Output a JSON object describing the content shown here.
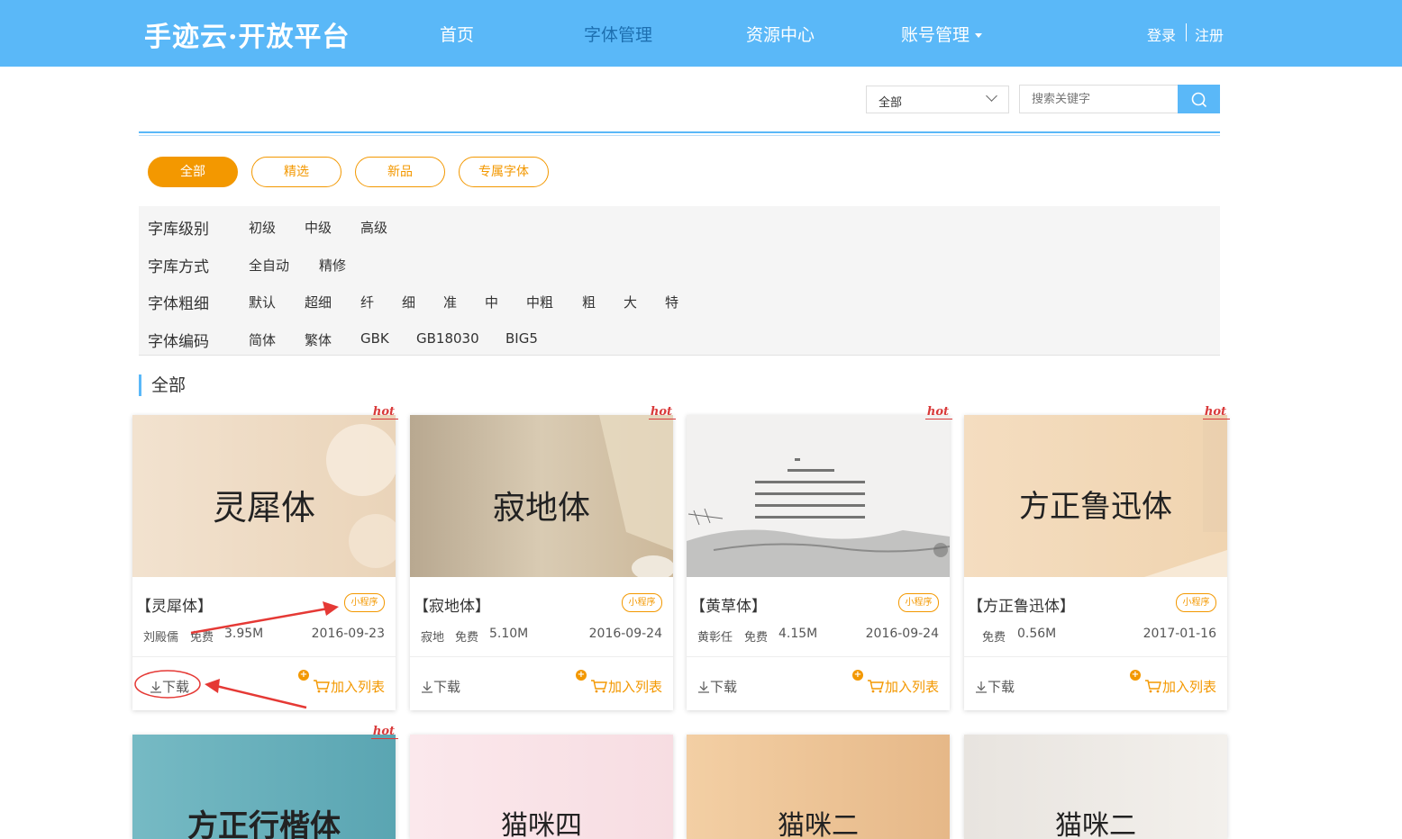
{
  "header": {
    "logo": "手迹云·开放平台",
    "nav": [
      "首页",
      "字体管理",
      "资源中心",
      "账号管理"
    ],
    "login": "登录",
    "register": "注册",
    "colors": {
      "bar": "#5ab8f8",
      "active_nav": "#1d6fb0"
    }
  },
  "search": {
    "category_selected": "全部",
    "placeholder": "搜索关键字",
    "button_icon": "search-icon"
  },
  "tabs": [
    "全部",
    "精选",
    "新品",
    "专属字体"
  ],
  "active_tab": "全部",
  "filters": [
    {
      "label": "字库级别",
      "options": [
        "初级",
        "中级",
        "高级"
      ]
    },
    {
      "label": "字库方式",
      "options": [
        "全自动",
        "精修"
      ]
    },
    {
      "label": "字体粗细",
      "options": [
        "默认",
        "超细",
        "纤",
        "细",
        "准",
        "中",
        "中粗",
        "粗",
        "大",
        "特"
      ]
    },
    {
      "label": "字体编码",
      "options": [
        "简体",
        "繁体",
        "GBK",
        "GB18030",
        "BIG5"
      ]
    }
  ],
  "section_title": "全部",
  "accent_color": "#f39800",
  "cards": [
    {
      "title": "【灵犀体】",
      "preview": "灵犀体",
      "hot": "hot",
      "badge": "小程序",
      "author": "刘殿儒",
      "price": "免费",
      "size": "3.95M",
      "date": "2016-09-23",
      "download": "下载",
      "add": "加入列表"
    },
    {
      "title": "【寂地体】",
      "preview": "寂地体",
      "hot": "hot",
      "badge": "小程序",
      "author": "寂地",
      "price": "免费",
      "size": "5.10M",
      "date": "2016-09-24",
      "download": "下载",
      "add": "加入列表"
    },
    {
      "title": "【黄草体】",
      "preview": "",
      "hot": "hot",
      "badge": "小程序",
      "author": "黄彰任",
      "price": "免费",
      "size": "4.15M",
      "date": "2016-09-24",
      "download": "下载",
      "add": "加入列表"
    },
    {
      "title": "【方正鲁迅体】",
      "preview": "方正鲁迅体",
      "hot": "hot",
      "badge": "小程序",
      "author": "",
      "price": "免费",
      "size": "0.56M",
      "date": "2017-01-16",
      "download": "下载",
      "add": "加入列表"
    },
    {
      "preview": "方正行楷体",
      "hot": "hot"
    },
    {
      "preview": "猫咪四"
    },
    {
      "preview": "猫咪二"
    },
    {
      "preview": "猫咪二"
    }
  ]
}
